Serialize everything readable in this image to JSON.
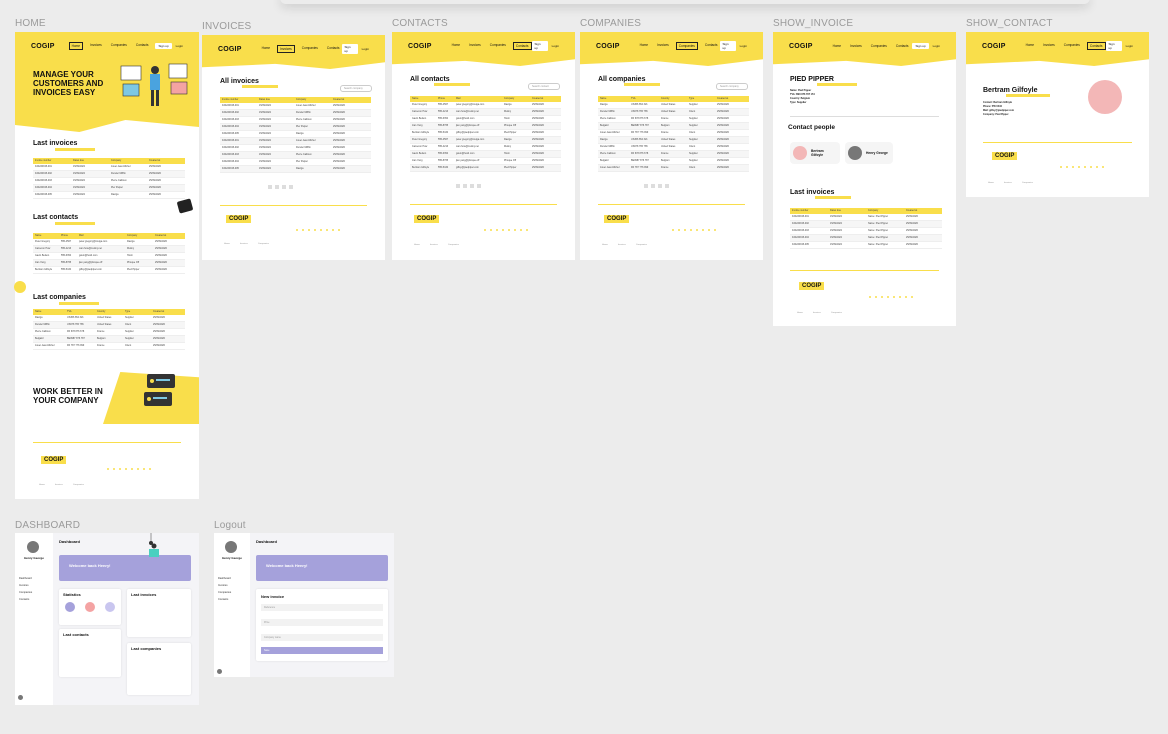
{
  "brand": {
    "logo": "COGIP",
    "accent": "#f9de4b",
    "purple": "#a5a1db"
  },
  "frame_labels": {
    "home": "HOME",
    "invoices": "INVOICES",
    "contacts": "CONTACTS",
    "companies": "COMPANIES",
    "show_invoice": "SHOW_INVOICE",
    "show_contact": "SHOW_CONTACT",
    "dashboard": "DASHBOARD",
    "logout": "Logout"
  },
  "nav": {
    "links": [
      "Home",
      "Invoices",
      "Companies",
      "Contacts"
    ],
    "signup": "Sign up",
    "login": "Login"
  },
  "home": {
    "hero_title": "MANAGE YOUR CUSTOMERS AND INVOICES EASY",
    "last_invoices": "Last invoices",
    "last_contacts": "Last contacts",
    "last_companies": "Last companies",
    "work_title": "WORK BETTER IN YOUR COMPANY",
    "invoice_headers": [
      "Invoice number",
      "Dates due",
      "Company",
      "Created at"
    ],
    "invoice_rows": [
      [
        "F20220915-001",
        "15/09/2022",
        "Jouet Jean-Michel",
        "25/09/2020"
      ],
      [
        "F20220915-002",
        "15/09/2022",
        "Dunder Mifflin",
        "25/09/2020"
      ],
      [
        "F20220915-003",
        "15/09/2022",
        "Pierre Cailloux",
        "25/09/2020"
      ],
      [
        "F20220915-004",
        "15/09/2022",
        "Pier Papier",
        "25/09/2020"
      ],
      [
        "F20220915-005",
        "15/09/2022",
        "Raviga",
        "25/09/2020"
      ]
    ],
    "contact_headers": [
      "Name",
      "Phone",
      "Mail",
      "Company",
      "Created at"
    ],
    "contact_rows": [
      [
        "Peter Gregory",
        "555-4567",
        "peter.gregory@raviga.com",
        "Raviga",
        "25/09/2020"
      ],
      [
        "Cameron How",
        "555-4213",
        "cam.how@mutiny.net",
        "Mutiny",
        "25/09/2020"
      ],
      [
        "Gavin Belson",
        "555-6354",
        "gavin@hooli.com",
        "Hooli",
        "25/09/2020"
      ],
      [
        "Jian Yang",
        "555-8765",
        "jian.yang@phoque.off",
        "Phoque Off",
        "25/09/2020"
      ],
      [
        "Bertram Gilfoyle",
        "555-5434",
        "gilfoy@piedpiper.com",
        "Pied Pipper",
        "25/09/2020"
      ]
    ],
    "company_headers": [
      "Name",
      "TVA",
      "Country",
      "Type",
      "Created at"
    ],
    "company_rows": [
      [
        "Raviga",
        "US456 654 321",
        "United States",
        "Supplier",
        "25/09/2020"
      ],
      [
        "Dunder Mifflin",
        "US678 765 765",
        "United States",
        "Client",
        "25/09/2020"
      ],
      [
        "Pierre Cailloux",
        "FR 678 876 678",
        "France",
        "Supplier",
        "25/09/2020"
      ],
      [
        "Belgalol",
        "BE0987 876 787",
        "Belgium",
        "Supplier",
        "25/09/2020"
      ],
      [
        "Jouet Jean-Michel",
        "FR 787 776 999",
        "France",
        "Client",
        "25/09/2020"
      ]
    ]
  },
  "invoices_page": {
    "title": "All invoices",
    "search": "Search company"
  },
  "contacts_page": {
    "title": "All contacts",
    "search": "Search contact"
  },
  "companies_page": {
    "title": "All companies",
    "search": "Search company"
  },
  "show_invoice": {
    "company": "PIED PIPPER",
    "details": [
      "Name: Pied Pipper",
      "TVA: BE0 876 787 154",
      "Country: Belgium",
      "Type: Supplier"
    ],
    "contact_people": "Contact people",
    "people": [
      "Bertram Gilfoyle",
      "Henry George"
    ],
    "last_invoices": "Last invoices"
  },
  "show_contact": {
    "name": "Bertram Gilfoyle",
    "details": [
      "Contact: Bertram Gilfoyle",
      "Phone: 555-5434",
      "Mail: gilfoy@piedpiper.com",
      "Company: Pied Pipper"
    ]
  },
  "dashboard": {
    "user": "Henry George",
    "title": "Dashboard",
    "welcome": "Welcome back Henry!",
    "menu": [
      "Dashboard",
      "Invoices",
      "Companies",
      "Contacts"
    ],
    "stats": "Statistics",
    "last_invoices": "Last invoices",
    "last_contacts": "Last contacts",
    "last_companies": "Last companies"
  },
  "logout_page": {
    "title": "Dashboard",
    "welcome": "Welcome back Henry!",
    "form_title": "New invoice",
    "fields": [
      "Reference",
      "Price",
      "Company name"
    ],
    "submit": "Save"
  }
}
